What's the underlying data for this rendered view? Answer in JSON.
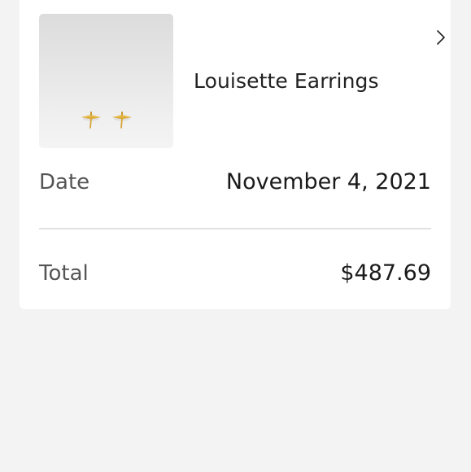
{
  "order": {
    "product": {
      "name": "Louisette Earrings",
      "image_icon": "earrings-product-image",
      "chevron_icon": "chevron-right-icon"
    },
    "date": {
      "label": "Date",
      "value": "November 4, 2021"
    },
    "total": {
      "label": "Total",
      "value": "$487.69"
    }
  },
  "colors": {
    "background": "#f3f3f3",
    "card": "#ffffff",
    "text_primary": "#1a1a1a",
    "text_secondary": "#555555",
    "divider": "#e2e2e2",
    "gold": "#d9a93a"
  }
}
